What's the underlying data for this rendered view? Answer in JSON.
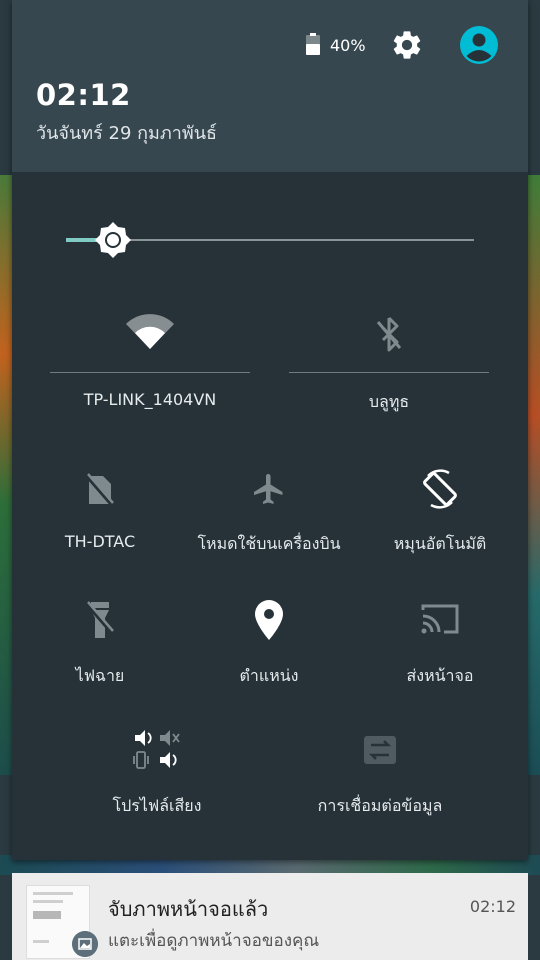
{
  "status": {
    "battery_percent": "40%",
    "time": "02:12",
    "date": "วันจันทร์ 29 กุมภาพันธ์"
  },
  "brightness": {
    "level": 0.08
  },
  "tiles": {
    "wifi": {
      "label": "TP-LINK_1404VN",
      "icon": "wifi-icon",
      "enabled": true
    },
    "bluetooth": {
      "label": "บลูทูธ",
      "icon": "bluetooth-disabled-icon",
      "enabled": false
    },
    "mobile": {
      "label": "TH-DTAC",
      "icon": "no-sim-icon",
      "enabled": false
    },
    "airplane": {
      "label": "โหมดใช้บนเครื่องบิน",
      "icon": "airplane-icon",
      "enabled": false
    },
    "rotate": {
      "label": "หมุนอัตโนมัติ",
      "icon": "screen-rotation-icon",
      "enabled": true
    },
    "flashlight": {
      "label": "ไฟฉาย",
      "icon": "flashlight-off-icon",
      "enabled": false
    },
    "location": {
      "label": "ตำแหน่ง",
      "icon": "location-pin-icon",
      "enabled": true
    },
    "cast": {
      "label": "ส่งหน้าจอ",
      "icon": "cast-icon",
      "enabled": false
    },
    "sound_profile": {
      "label": "โปรไฟล์เสียง",
      "icon": "sound-profile-icon",
      "enabled": true
    },
    "data_connection": {
      "label": "การเชื่อมต่อข้อมูล",
      "icon": "data-transfer-icon",
      "enabled": false
    }
  },
  "notification": {
    "title": "จับภาพหน้าจอแล้ว",
    "text": "แตะเพื่อดูภาพหน้าจอของคุณ",
    "time": "02:12",
    "icon": "image-icon"
  },
  "colors": {
    "shade_bg": "#263238",
    "header_bg": "#37474f",
    "accent": "#80cbc4",
    "avatar": "#00bcd4"
  }
}
